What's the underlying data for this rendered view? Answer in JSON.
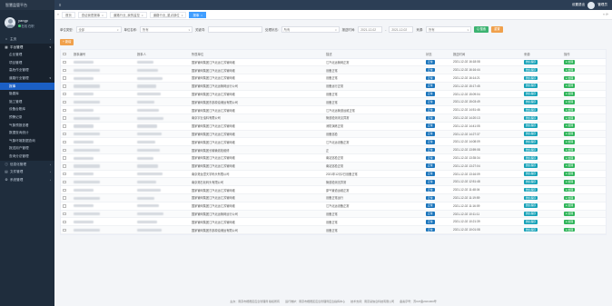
{
  "app": {
    "brand": "智慧监管平台"
  },
  "user": {
    "name": "yangp",
    "status": "在线",
    "role": "在职"
  },
  "sidebar": {
    "items": [
      {
        "label": "主页",
        "icon": "home-icon",
        "type": "top"
      },
      {
        "label": "平台管理",
        "icon": "grid-icon",
        "type": "group"
      },
      {
        "label": "企业管理",
        "type": "sub"
      },
      {
        "label": "项目管理",
        "type": "sub"
      },
      {
        "label": "高危作业管理",
        "type": "sub"
      },
      {
        "label": "道路行业管理",
        "type": "sub-group"
      },
      {
        "label": "报事",
        "type": "active"
      },
      {
        "label": "隐患库",
        "type": "sub"
      },
      {
        "label": "施工管理",
        "type": "sub"
      },
      {
        "label": "设备台账库",
        "type": "sub"
      },
      {
        "label": "预警记录",
        "type": "sub"
      },
      {
        "label": "气象预报查看",
        "type": "sub"
      },
      {
        "label": "数据查询统计",
        "type": "sub"
      },
      {
        "label": "气象环境数据查询",
        "type": "sub"
      },
      {
        "label": "报送用户管理",
        "type": "sub"
      },
      {
        "label": "查询分总管理",
        "type": "sub"
      },
      {
        "label": "信息化管理",
        "icon": "info-icon",
        "type": "top"
      },
      {
        "label": "文件管理",
        "icon": "file-icon",
        "type": "top"
      },
      {
        "label": "系统管理",
        "icon": "settings-icon",
        "type": "top"
      }
    ]
  },
  "topbar": {
    "right_label": "设置退出",
    "user": "管理员"
  },
  "tabs": [
    {
      "label": "首页",
      "active": false
    },
    {
      "label": "查证我是报事",
      "active": false
    },
    {
      "label": "道路行业_我的监控",
      "active": false
    },
    {
      "label": "道路行业_重点部位",
      "active": false
    },
    {
      "label": "报事",
      "active": true
    }
  ],
  "filters": {
    "unit_type_label": "单位类型:",
    "unit_type_value": "全部",
    "unit_name_label": "单位名称:",
    "unit_name_value": "所有",
    "keyword_label": "关键词:",
    "keyword_value": "",
    "status_label": "处理状态:",
    "status_value": "所有",
    "date_label": "报送时间:",
    "date_from": "2021-12-02",
    "date_to": "2021-12-02",
    "source_label": "来源:",
    "source_value": "所有",
    "search_btn": "Q 搜索",
    "reset_btn": "重置"
  },
  "toolbar": {
    "add_btn": "+ 新增"
  },
  "table": {
    "headers": [
      "",
      "报事编号",
      "报事人",
      "所属单位",
      "描述",
      "状态",
      "报送时间",
      "来源",
      "操作"
    ],
    "rows": [
      {
        "unit": "国家管网集团江汽北运江苏管网维",
        "desc": "江汽北运管网正常",
        "status": "正常",
        "time": "2021-12-02 16:18:08",
        "source": "微信程序",
        "op": "● 处理"
      },
      {
        "unit": "国家管网集团江汽北运江苏管网维",
        "desc": "设备正常",
        "status": "正常",
        "time": "2021-12-02 16:16:44",
        "source": "微信程序",
        "op": "● 处理"
      },
      {
        "unit": "国家管网集团江汽北运江苏管网维",
        "desc": "设备正常",
        "status": "正常",
        "time": "2021-12-02 16:14:21",
        "source": "微信程序",
        "op": "● 处理"
      },
      {
        "unit": "国家管网集团江汽北运管网运行公司",
        "desc": "设备运行正常",
        "status": "正常",
        "time": "2021-12-02 15:17:45",
        "source": "微信程序",
        "op": "● 处理"
      },
      {
        "unit": "国家管网集团江汽北运江苏管网维",
        "desc": "设备正常",
        "status": "正常",
        "time": "2021-12-02 15:09:04",
        "source": "微信程序",
        "op": "● 处理"
      },
      {
        "unit": "国家管网集团东部原油储运有限公司",
        "desc": "设备正常",
        "status": "正常",
        "time": "2021-12-02 15:03:49",
        "source": "微信程序",
        "op": "● 处理"
      },
      {
        "unit": "国家管网集团江汽北运江苏管网维",
        "desc": "江汽北运管道运维正常",
        "status": "正常",
        "time": "2021-12-02 14:51:46",
        "source": "微信程序",
        "op": "● 处理"
      },
      {
        "unit": "南京宇业油料有限公司",
        "desc": "管道检测未见异常",
        "status": "正常",
        "time": "2021-12-02 14:20:13",
        "source": "微信程序",
        "op": "● 处理"
      },
      {
        "unit": "国家管网集团江汽北运江苏管网维",
        "desc": "消防演练正常",
        "status": "正常",
        "time": "2021-12-02 14:41:05",
        "source": "微信程序",
        "op": "● 处理"
      },
      {
        "unit": "国家管网集团江汽北运江苏管网维",
        "desc": "设备巡检",
        "status": "正常",
        "time": "2021-12-02 14:27:37",
        "source": "微信程序",
        "op": "● 处理"
      },
      {
        "unit": "国家管网集团江汽北运江苏管网维",
        "desc": "江汽北运设备正常",
        "status": "正常",
        "time": "2021-12-02 14:08:09",
        "source": "微信程序",
        "op": "● 处理"
      },
      {
        "unit": "国家管网集团长输管线检维修",
        "desc": "正",
        "status": "正常",
        "time": "2021-12-02 13:59:08",
        "source": "微信程序",
        "op": "● 处理"
      },
      {
        "unit": "国家管网集团江汽北运江苏管网维",
        "desc": "南站巡检正常",
        "status": "正常",
        "time": "2021-12-02 13:35:34",
        "source": "微信程序",
        "op": "● 处理"
      },
      {
        "unit": "国家管网集团江汽北运江苏管网维",
        "desc": "南站巡检正常",
        "status": "正常",
        "time": "2021-12-02 13:27:04",
        "source": "微信程序",
        "op": "● 处理"
      },
      {
        "unit": "南京港龙潭天宇码头有限公司",
        "desc": "2021年12月2日设备正常",
        "status": "正常",
        "time": "2021-12-02 13:16:09",
        "source": "微信程序",
        "op": "● 处理"
      },
      {
        "unit": "南京港石化码头有限公司",
        "desc": "管道检测无异常",
        "status": "正常",
        "time": "2021-12-02 12:51:48",
        "source": "微信程序",
        "op": "● 处理"
      },
      {
        "unit": "国家管网集团江汽北运江苏管网维",
        "desc": "原气管道运维正常",
        "status": "正常",
        "time": "2021-12-02 11:48:04",
        "source": "微信程序",
        "op": "● 处理"
      },
      {
        "unit": "国家管网集团江汽北运江苏管网维",
        "desc": "设备正常运行",
        "status": "正常",
        "time": "2021-12-02 11:19:59",
        "source": "微信程序",
        "op": "● 处理"
      },
      {
        "unit": "国家管网集团江汽北运江苏管网维",
        "desc": "江汽北运设备正常",
        "status": "正常",
        "time": "2021-12-02 11:16:09",
        "source": "微信程序",
        "op": "● 处理"
      },
      {
        "unit": "国家管网集团江汽北运管网运行公司",
        "desc": "设备正常",
        "status": "正常",
        "time": "2021-12-02 10:11:11",
        "source": "微信程序",
        "op": "● 处理"
      },
      {
        "unit": "国家管网集团江汽北运江苏管网维",
        "desc": "设备正常",
        "status": "正常",
        "time": "2021-12-02 10:21:39",
        "source": "微信程序",
        "op": "● 处理"
      },
      {
        "unit": "国家管网集团东部原油储运有限公司",
        "desc": "设备正常",
        "status": "正常",
        "time": "2021-12-02 10:01:08",
        "source": "微信程序",
        "op": "● 处理"
      }
    ]
  },
  "footer": {
    "org": "主办：南京市栖霞区应急管理局 版权所有",
    "ops": "运行维护：南京市栖霞区应急管理局应急指挥中心",
    "tech": "技术支持：南京某信息科技有限公司",
    "icp": "备案序号：苏ICP备2021000号"
  }
}
